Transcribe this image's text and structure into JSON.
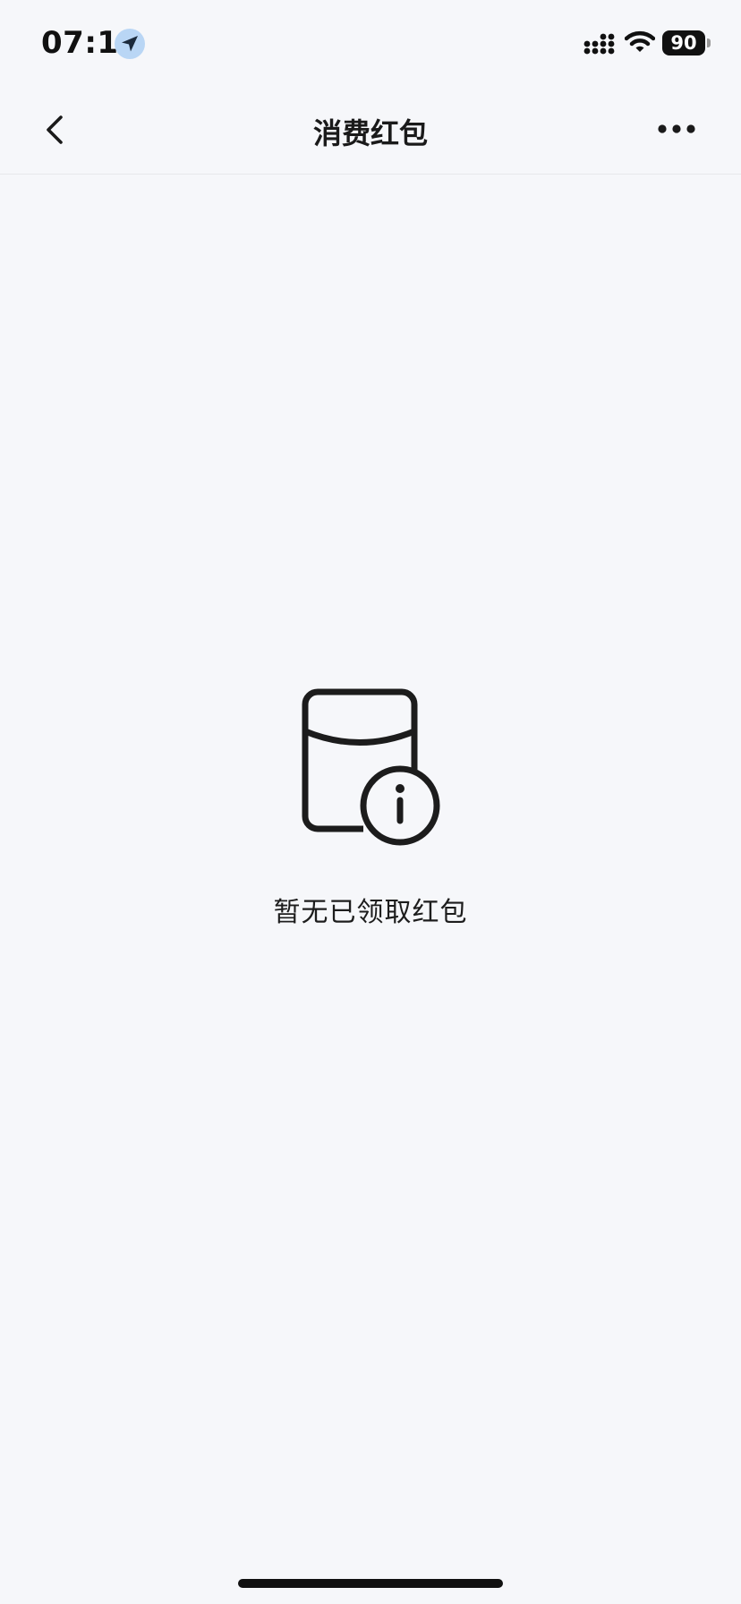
{
  "status_bar": {
    "time": "07:11",
    "battery_level": "90",
    "icons": [
      "location-arrow-icon",
      "cellular-signal-icon",
      "wifi-icon",
      "battery-icon"
    ]
  },
  "nav": {
    "title": "消费红包",
    "back_icon": "chevron-left-icon",
    "more_icon": "more-dots-icon"
  },
  "empty_state": {
    "icon": "red-packet-info-icon",
    "message": "暂无已领取红包"
  },
  "colors": {
    "background": "#f6f7fa",
    "text_primary": "#1a1a1a",
    "location_badge": "#b9d6f5"
  }
}
